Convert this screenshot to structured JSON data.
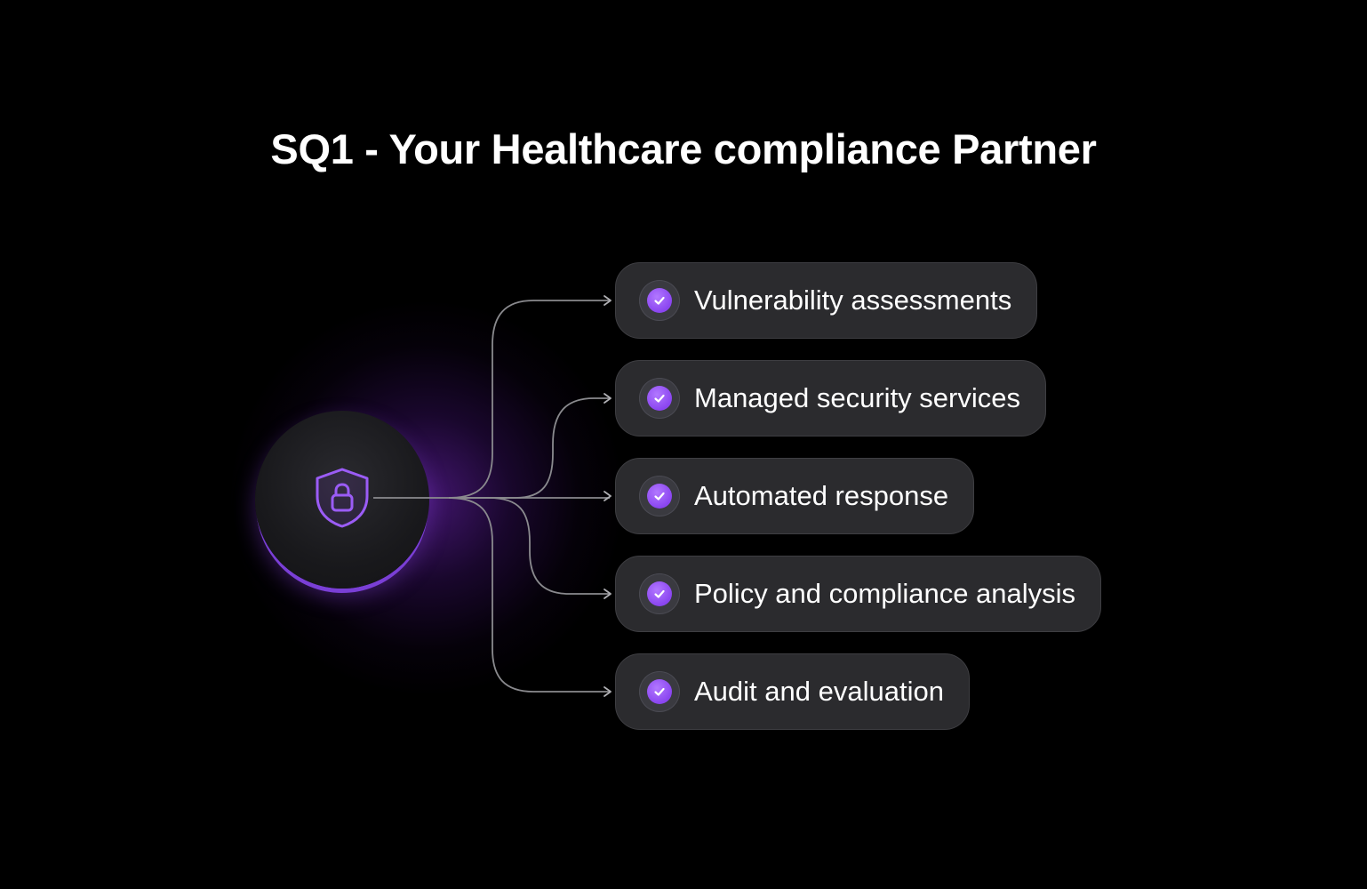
{
  "title": "SQ1 - Your Healthcare compliance Partner",
  "hub": {
    "icon": "shield-lock-icon",
    "accent": "#8a45f0"
  },
  "items": [
    {
      "label": "Vulnerability assessments",
      "icon": "check-circle-icon"
    },
    {
      "label": "Managed security services",
      "icon": "check-circle-icon"
    },
    {
      "label": "Automated response",
      "icon": "check-circle-icon"
    },
    {
      "label": "Policy and compliance analysis",
      "icon": "check-circle-icon"
    },
    {
      "label": "Audit and evaluation",
      "icon": "check-circle-icon"
    }
  ],
  "colors": {
    "background": "#000000",
    "pill": "#2b2b2e",
    "accent": "#8a45f0",
    "connector": "#8a8a8e"
  }
}
